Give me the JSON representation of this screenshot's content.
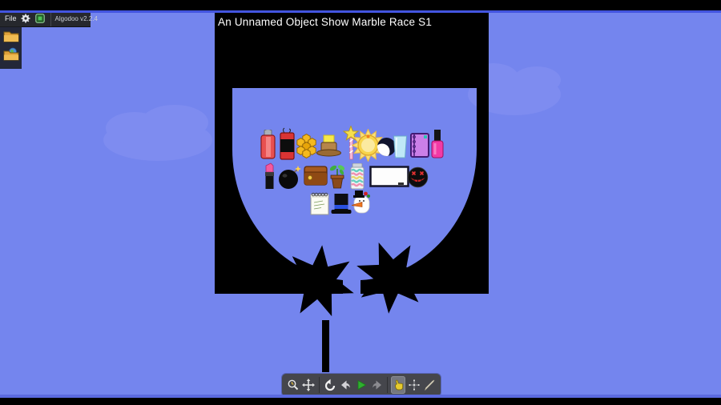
{
  "menu": {
    "file_label": "File",
    "version_label": "Algodoo v2.2.4",
    "icons": [
      "gear-icon",
      "plugins-icon"
    ]
  },
  "side_panel": {
    "folders": [
      "open-folder-icon",
      "browse-online-folder-icon"
    ]
  },
  "scene": {
    "title": "An Unnamed Object Show Marble Race S1",
    "container": "black-bowl-with-gear-release",
    "marbles_row1": [
      "spray-can",
      "dynamite",
      "honeycomb",
      "buttered-hat",
      "star-wand",
      "sun",
      "moon",
      "glass-of-water",
      "notebook",
      "nail-polish"
    ],
    "marbles_row2": [
      "lipstick",
      "bomb",
      "wallet",
      "sapling",
      "candy-jar",
      "whiteboard",
      "scary-face"
    ],
    "marbles_row3": [
      "notepad",
      "top-hat",
      "snowman"
    ]
  },
  "toolbar": {
    "tools": [
      "zoom-tool",
      "pan-tool",
      "undo-tool",
      "back-tool",
      "play-tool",
      "redo-tool",
      "drag-tool",
      "move-tool",
      "brush-tool"
    ],
    "selected_tool": "drag-tool"
  },
  "colors": {
    "background": "#7485ee",
    "cloud": "#7e8cf0",
    "container": "#000000",
    "accent_line": "#4355e0",
    "play_green": "#2fae2f",
    "drag_hand_yellow": "#e7cb2e",
    "title_text": "#ffffff"
  }
}
